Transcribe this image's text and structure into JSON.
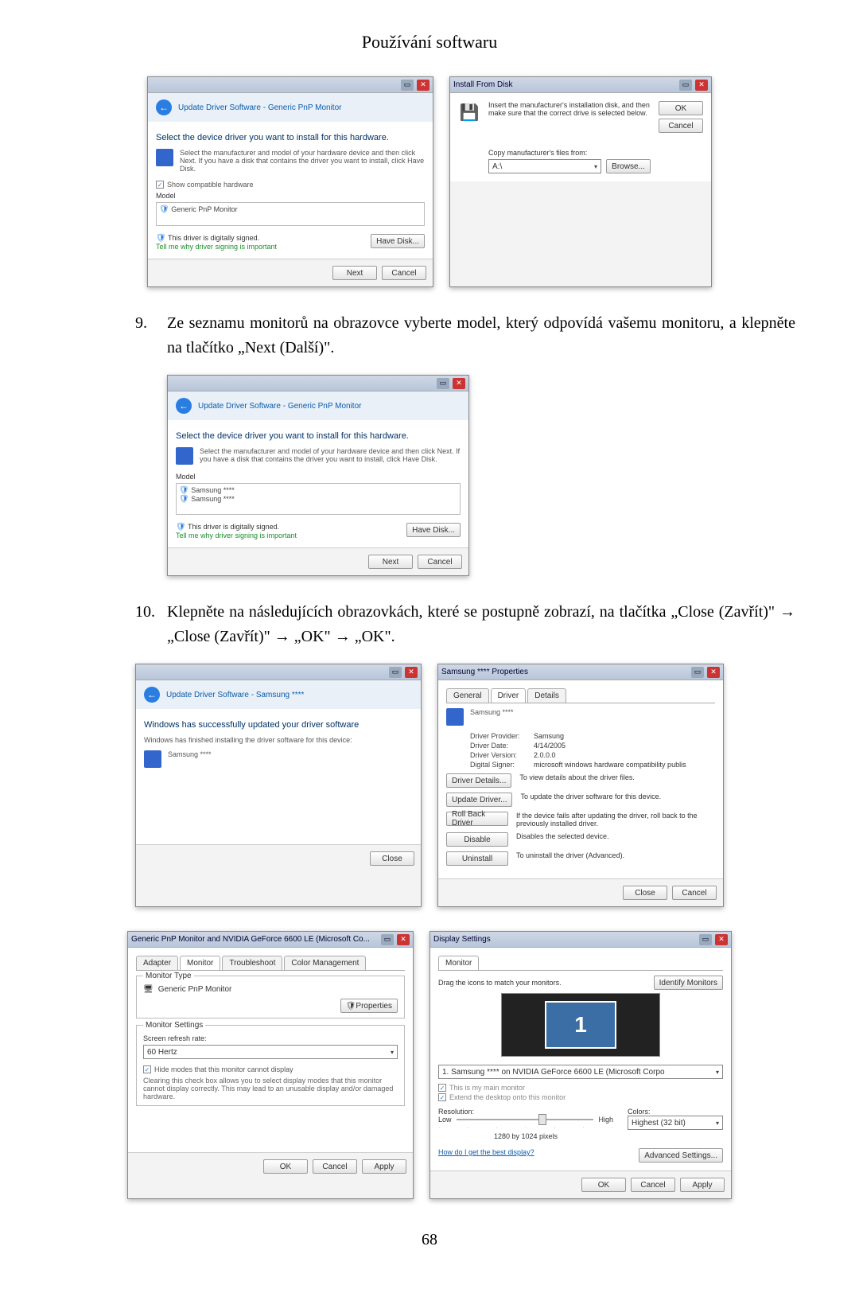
{
  "page_title": "Používání softwaru",
  "page_number": "68",
  "steps": {
    "s9_num": "9.",
    "s9_text": "Ze seznamu monitorů na obrazovce vyberte model, který odpovídá vašemu monitoru, a klepněte na tlačítko „Next (Další)\".",
    "s10_num": "10.",
    "s10_text": "Klepněte na následujících obrazovkách, které se postupně zobrazí, na tlačítka „Close (Zavřít)\" → „Close (Zavřít)\" → „OK\" → „OK\"."
  },
  "win1": {
    "breadcrumb": "Update Driver Software - Generic PnP Monitor",
    "heading": "Select the device driver you want to install for this hardware.",
    "desc": "Select the manufacturer and model of your hardware device and then click Next. If you have a disk that contains the driver you want to install, click Have Disk.",
    "show_compat": "Show compatible hardware",
    "model_label": "Model",
    "model_item": "Generic PnP Monitor",
    "signed": "This driver is digitally signed.",
    "why": "Tell me why driver signing is important",
    "have_disk": "Have Disk...",
    "next": "Next",
    "cancel": "Cancel"
  },
  "win2": {
    "title": "Install From Disk",
    "msg": "Insert the manufacturer's installation disk, and then make sure that the correct drive is selected below.",
    "ok": "OK",
    "cancel": "Cancel",
    "copy_label": "Copy manufacturer's files from:",
    "drive": "A:\\",
    "browse": "Browse..."
  },
  "win3": {
    "breadcrumb": "Update Driver Software - Generic PnP Monitor",
    "heading": "Select the device driver you want to install for this hardware.",
    "desc": "Select the manufacturer and model of your hardware device and then click Next. If you have a disk that contains the driver you want to install, click Have Disk.",
    "model_label": "Model",
    "item1": "Samsung ****",
    "item2": "Samsung ****",
    "signed": "This driver is digitally signed.",
    "why": "Tell me why driver signing is important",
    "have_disk": "Have Disk...",
    "next": "Next",
    "cancel": "Cancel"
  },
  "win4": {
    "breadcrumb": "Update Driver Software - Samsung ****",
    "heading": "Windows has successfully updated your driver software",
    "sub": "Windows has finished installing the driver software for this device:",
    "device": "Samsung ****",
    "close": "Close"
  },
  "win5": {
    "title": "Samsung **** Properties",
    "tab_general": "General",
    "tab_driver": "Driver",
    "tab_details": "Details",
    "device": "Samsung ****",
    "provider_k": "Driver Provider:",
    "provider_v": "Samsung",
    "date_k": "Driver Date:",
    "date_v": "4/14/2005",
    "version_k": "Driver Version:",
    "version_v": "2.0.0.0",
    "signer_k": "Digital Signer:",
    "signer_v": "microsoft windows hardware compatibility publis",
    "b_details": "Driver Details...",
    "b_details_desc": "To view details about the driver files.",
    "b_update": "Update Driver...",
    "b_update_desc": "To update the driver software for this device.",
    "b_rollback": "Roll Back Driver",
    "b_rollback_desc": "If the device fails after updating the driver, roll back to the previously installed driver.",
    "b_disable": "Disable",
    "b_disable_desc": "Disables the selected device.",
    "b_uninstall": "Uninstall",
    "b_uninstall_desc": "To uninstall the driver (Advanced).",
    "close": "Close",
    "cancel": "Cancel"
  },
  "win6": {
    "title": "Generic PnP Monitor and NVIDIA GeForce 6600 LE (Microsoft Co...",
    "tab_adapter": "Adapter",
    "tab_monitor": "Monitor",
    "tab_ts": "Troubleshoot",
    "tab_cm": "Color Management",
    "mt_legend": "Monitor Type",
    "mt_name": "Generic PnP Monitor",
    "properties": "Properties",
    "ms_legend": "Monitor Settings",
    "refresh_label": "Screen refresh rate:",
    "refresh_value": "60 Hertz",
    "hide": "Hide modes that this monitor cannot display",
    "hide_desc": "Clearing this check box allows you to select display modes that this monitor cannot display correctly. This may lead to an unusable display and/or damaged hardware.",
    "ok": "OK",
    "cancel": "Cancel",
    "apply": "Apply"
  },
  "win7": {
    "title": "Display Settings",
    "tab_monitor": "Monitor",
    "drag": "Drag the icons to match your monitors.",
    "identify": "Identify Monitors",
    "mon_num": "1",
    "sel_label": "1. Samsung **** on NVIDIA GeForce 6600 LE (Microsoft Corpo",
    "main": "This is my main monitor",
    "extend": "Extend the desktop onto this monitor",
    "res_label": "Resolution:",
    "low": "Low",
    "high": "High",
    "res_value": "1280 by 1024 pixels",
    "colors_label": "Colors:",
    "colors_value": "Highest (32 bit)",
    "best": "How do I get the best display?",
    "advanced": "Advanced Settings...",
    "ok": "OK",
    "cancel": "Cancel",
    "apply": "Apply"
  }
}
